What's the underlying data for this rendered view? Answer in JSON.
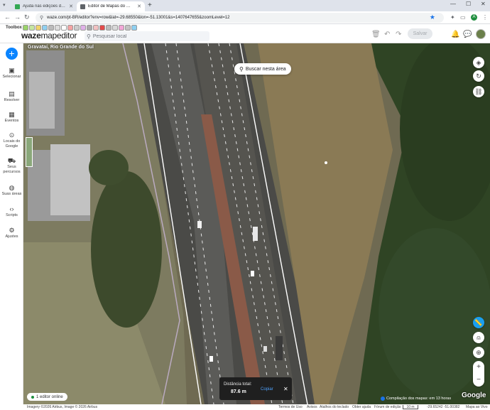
{
  "browser": {
    "tabs": [
      {
        "title": "Ajuda nas edições do mapa | Fó",
        "active": false,
        "favicon_color": "#34a853"
      },
      {
        "title": "Editor de Mapas do Waze",
        "active": true,
        "favicon_color": "#5f6368"
      }
    ],
    "url": "waze.com/pt-BR/editor?env=row&lat=-29.68550&lon=-51.13001&s=1407647655&zoomLevel=12",
    "profile_initial": "A"
  },
  "toolbar": {
    "toolbox_label": "Toolbox",
    "logo_bold": "waze",
    "logo_light": "mapeditor",
    "search_placeholder": "Pesquisar local",
    "save_label": "Salvar"
  },
  "sidebar": {
    "add_icon": "plus-icon",
    "items": [
      {
        "label": "Selecionar",
        "icon": "layers-select-icon"
      },
      {
        "label": "Resolver",
        "icon": "clipboard-icon"
      },
      {
        "label": "Eventos",
        "icon": "calendar-icon"
      },
      {
        "label": "Locais do Google",
        "icon": "pin-icon"
      },
      {
        "label": "Seus percursos",
        "icon": "car-icon"
      },
      {
        "label": "Suas áreas",
        "icon": "globe-icon"
      },
      {
        "label": "Scripts",
        "icon": "code-icon"
      },
      {
        "label": "Ajustes",
        "icon": "gear-icon"
      }
    ]
  },
  "map": {
    "location_label": "Gravataí, Rio Grande do Sul",
    "search_here_label": "Buscar nesta área",
    "editors_online": "1 editor online",
    "distance": {
      "label": "Distância total:",
      "value": "87.6 m",
      "copy_label": "Copiar",
      "close": "✕"
    },
    "compile_notice": "Compilação dos mapas: em 13 horas",
    "attribution_brand": "Google"
  },
  "footer": {
    "imagery": "Imagery ©2026 Airbus, Image © 2026 Airbus",
    "terms": "Termos de Uso",
    "notices": "Avisos",
    "shortcuts": "Atalhos do teclado",
    "help": "Obter ajuda",
    "forum": "Fórum de edição",
    "scale": "10 m",
    "coords": "-29.65242 -51.00382",
    "map_key": "Mapa ao Vivo"
  },
  "colors": {
    "accent": "#0a84ff",
    "distance_copy": "#4fa3ff"
  }
}
